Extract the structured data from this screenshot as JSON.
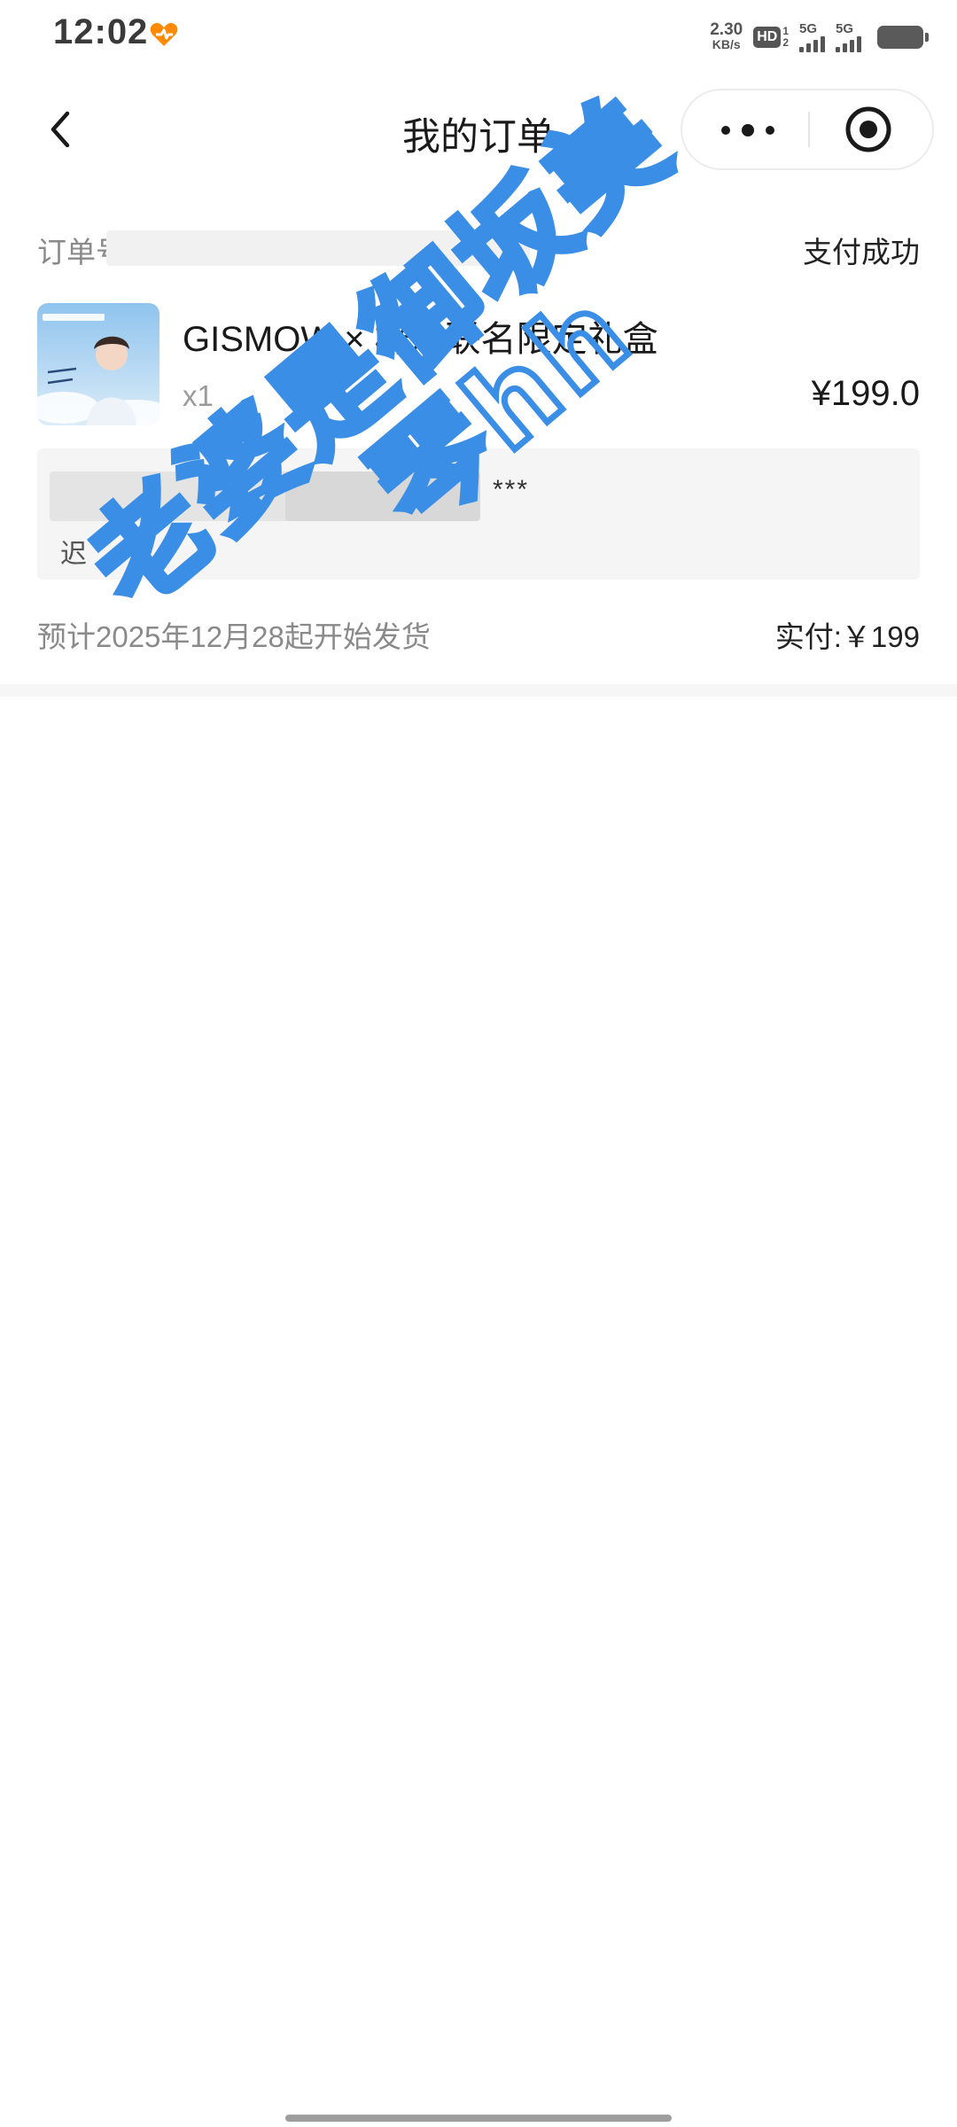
{
  "status_bar": {
    "time": "12:02",
    "net_speed_value": "2.30",
    "net_speed_unit": "KB/s",
    "hd_label": "HD",
    "hd_sim_1": "1",
    "hd_sim_2": "2",
    "sim1_label": "5G",
    "sim2_label": "5G",
    "icons": [
      "heart-icon",
      "signal-icon",
      "battery-icon"
    ]
  },
  "nav": {
    "title": "我的订单",
    "icons": [
      "back-icon",
      "more-icon",
      "target-icon"
    ]
  },
  "order": {
    "order_no_label": "订单号",
    "status": "支付成功",
    "product": {
      "name": "GISMOW × 梓渝联名限定礼盒",
      "quantity": "x1",
      "price": "¥199.0"
    },
    "address": {
      "masked": "***",
      "glyph": "迟"
    },
    "ship_note": "预计2025年12月28起开始发货",
    "paid_total": "实付:￥199"
  },
  "watermark": {
    "line1": "老婆是御坂美",
    "line2": "琴hh",
    "color": "#3a8ee6"
  },
  "colors": {
    "accent_orange": "#ff8a00",
    "watermark_blue": "#3a8ee6"
  }
}
